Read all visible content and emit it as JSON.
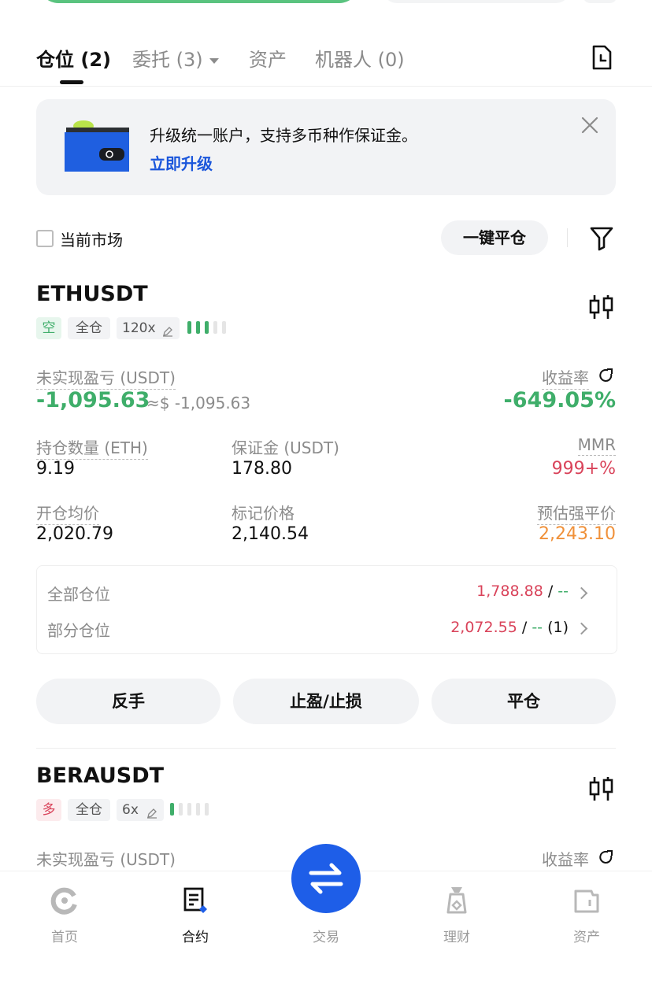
{
  "tabs": [
    {
      "label": "仓位 (2)",
      "active": true
    },
    {
      "label": "委托 (3)",
      "has_dropdown": true
    },
    {
      "label": "资产"
    },
    {
      "label": "机器人 (0)"
    }
  ],
  "banner": {
    "text": "升级统一账户，支持多币种作保证金。",
    "link": "立即升级"
  },
  "filters": {
    "current_market": "当前市场",
    "close_all": "一键平仓"
  },
  "positions": [
    {
      "symbol": "ETHUSDT",
      "side": "空",
      "margin_mode": "全仓",
      "leverage": "120x",
      "risk_level": 3,
      "risk_max": 5,
      "pnl_label": "未实现盈亏 (USDT)",
      "pnl": "-1,095.63",
      "pnl_approx": "≈$ -1,095.63",
      "roe_label": "收益率",
      "roe": "-649.05%",
      "qty_label": "持仓数量 (ETH)",
      "qty": "9.19",
      "margin_label": "保证金 (USDT)",
      "margin": "178.80",
      "mmr_label": "MMR",
      "mmr": "999+%",
      "entry_label": "开仓均价",
      "entry": "2,020.79",
      "mark_label": "标记价格",
      "mark": "2,140.54",
      "liq_label": "预估强平价",
      "liq": "2,243.10",
      "tpsl": {
        "full_label": "全部仓位",
        "full_value": "1,788.88",
        "full_sep": "/",
        "full_dash": "--",
        "partial_label": "部分仓位",
        "partial_value": "2,072.55",
        "partial_sep": "/",
        "partial_dash": "--",
        "partial_count": "(1)"
      },
      "actions": [
        "反手",
        "止盈/止损",
        "平仓"
      ]
    },
    {
      "symbol": "BERAUSDT",
      "side": "多",
      "margin_mode": "全仓",
      "leverage": "6x",
      "risk_level": 1,
      "risk_max": 5,
      "pnl_label": "未实现盈亏 (USDT)",
      "roe_label": "收益率"
    }
  ],
  "bottom_nav": [
    {
      "label": "首页",
      "icon": "home-icon"
    },
    {
      "label": "合约",
      "icon": "futures-icon",
      "active": true
    },
    {
      "label": "交易",
      "icon": "swap-icon"
    },
    {
      "label": "理财",
      "icon": "earn-icon"
    },
    {
      "label": "资产",
      "icon": "wallet-icon"
    }
  ],
  "colors": {
    "accent_blue": "#1e5ee8",
    "profit_green": "#3fae6a",
    "loss_red": "#d9435a",
    "warning_orange": "#f0913a"
  }
}
